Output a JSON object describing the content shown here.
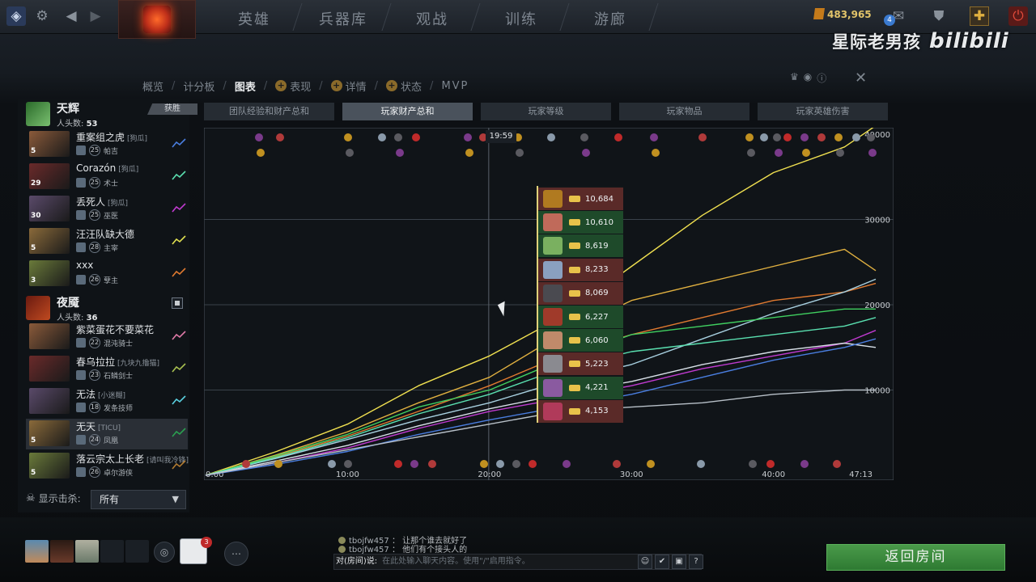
{
  "topbar": {
    "nav": [
      "英雄",
      "兵器库",
      "观战",
      "训练",
      "游廊"
    ],
    "gold": "483,965",
    "notif_count": "4",
    "watermark": "星际老男孩",
    "watermark_brand": "bilibili"
  },
  "subtabs": [
    "概览",
    "计分板",
    "图表",
    "表现",
    "详情",
    "状态",
    "MVP"
  ],
  "graph_tabs": [
    "团队经验和财产总和",
    "玩家财产总和",
    "玩家等级",
    "玩家物品",
    "玩家英雄伤害"
  ],
  "radiant": {
    "name": "天辉",
    "kills_label": "人头数:",
    "kills": "53",
    "result": "获胜",
    "players": [
      {
        "name": "重案组之虎",
        "tag": "[狗瓜]",
        "level": "25",
        "hero": "帕吉",
        "plevel": "5",
        "color": "#4a7ee0"
      },
      {
        "name": "Corazón",
        "tag": "[狗瓜]",
        "level": "25",
        "hero": "术士",
        "plevel": "29",
        "color": "#5ae0b0"
      },
      {
        "name": "丢死人",
        "tag": "[狗瓜]",
        "level": "25",
        "hero": "巫医",
        "plevel": "30",
        "color": "#c03ad0"
      },
      {
        "name": "汪汪队缺大德",
        "tag": "",
        "level": "28",
        "hero": "主宰",
        "plevel": "5",
        "color": "#e0e050"
      },
      {
        "name": "xxx",
        "tag": "",
        "level": "26",
        "hero": "孽主",
        "plevel": "3",
        "color": "#e07a30"
      }
    ]
  },
  "dire": {
    "name": "夜魇",
    "kills_label": "人头数:",
    "kills": "36",
    "players": [
      {
        "name": "紫菜蛋花不要菜花",
        "tag": "",
        "level": "22",
        "hero": "混沌骑士",
        "plevel": "",
        "color": "#e07aa8"
      },
      {
        "name": "春乌拉拉",
        "tag": "[九块九撸猫]",
        "level": "23",
        "hero": "石鳞剑士",
        "plevel": "",
        "color": "#a8c050"
      },
      {
        "name": "无法",
        "tag": "[小迷糊]",
        "level": "18",
        "hero": "发条技师",
        "plevel": "",
        "color": "#5ad0e0"
      },
      {
        "name": "无天",
        "tag": "[TICU]",
        "level": "24",
        "hero": "凤凰",
        "plevel": "5",
        "color": "#2aa050"
      },
      {
        "name": "落云宗太上长老",
        "tag": "[请叫我冷锋]",
        "level": "26",
        "hero": "卓尔游侠",
        "plevel": "5",
        "color": "#b07a30"
      }
    ]
  },
  "kill_filter": {
    "label": "显示击杀:",
    "value": "所有"
  },
  "chart_data": {
    "type": "line",
    "title": "玩家财产总和",
    "x_ticks": [
      "0:00",
      "10:00",
      "20:00",
      "30:00",
      "40:00",
      "47:13"
    ],
    "y_ticks": [
      "40000",
      "30000",
      "20000",
      "10000"
    ],
    "xlim": [
      0,
      47.2
    ],
    "ylim": [
      0,
      40000
    ],
    "x": [
      0,
      5,
      10,
      15,
      20,
      25,
      30,
      35,
      40,
      45,
      47.2
    ],
    "series": [
      {
        "color": "#f0e050",
        "values": [
          0,
          2800,
          6000,
          10500,
          14000,
          18500,
          24500,
          30500,
          35500,
          38500,
          41000
        ]
      },
      {
        "color": "#e0b040",
        "values": [
          0,
          2400,
          5100,
          8500,
          11500,
          16500,
          20500,
          22500,
          24500,
          26500,
          24000
        ]
      },
      {
        "color": "#e07a30",
        "values": [
          0,
          2200,
          4600,
          7500,
          10500,
          14000,
          16500,
          18500,
          20500,
          21500,
          22500
        ]
      },
      {
        "color": "#a8d0e0",
        "values": [
          0,
          2000,
          4200,
          6500,
          8500,
          11000,
          13000,
          16000,
          19000,
          21500,
          23000
        ]
      },
      {
        "color": "#40d060",
        "values": [
          0,
          2300,
          4800,
          8000,
          10000,
          13500,
          16500,
          17500,
          18500,
          19500,
          19500
        ]
      },
      {
        "color": "#5ae0b0",
        "values": [
          0,
          2100,
          4400,
          7200,
          9500,
          12500,
          14500,
          15500,
          16500,
          17500,
          18500
        ]
      },
      {
        "color": "#c03ad0",
        "values": [
          0,
          1500,
          3200,
          5500,
          7500,
          9000,
          10500,
          12500,
          14000,
          15500,
          17000
        ]
      },
      {
        "color": "#d8e0e8",
        "values": [
          0,
          1700,
          3500,
          5800,
          7800,
          9500,
          11000,
          13000,
          14500,
          15500,
          15000
        ]
      },
      {
        "color": "#4a7ee0",
        "values": [
          0,
          1300,
          2800,
          4800,
          6500,
          8000,
          9500,
          11500,
          13500,
          15000,
          16000
        ]
      },
      {
        "color": "#b8c0c8",
        "values": [
          0,
          1500,
          3000,
          4500,
          6000,
          7500,
          8000,
          8500,
          9500,
          10000,
          10000
        ]
      }
    ]
  },
  "time_marker": "19:59",
  "tooltip": [
    {
      "value": "10,684",
      "bg": "#5a2a28",
      "icon": "#b07a20"
    },
    {
      "value": "10,610",
      "bg": "#1e4a2a",
      "icon": "#c06a5a"
    },
    {
      "value": "8,619",
      "bg": "#1e4a2a",
      "icon": "#7ab060"
    },
    {
      "value": "8,233",
      "bg": "#5a2a28",
      "icon": "#8aa0c0"
    },
    {
      "value": "8,069",
      "bg": "#5a2a28",
      "icon": "#4a4a50"
    },
    {
      "value": "6,227",
      "bg": "#1e4a2a",
      "icon": "#a03a2a"
    },
    {
      "value": "6,060",
      "bg": "#1e4a2a",
      "icon": "#c08a6a"
    },
    {
      "value": "5,223",
      "bg": "#5a2a28",
      "icon": "#8a8a90"
    },
    {
      "value": "4,221",
      "bg": "#1e4a2a",
      "icon": "#8a5aa0"
    },
    {
      "value": "4,153",
      "bg": "#5a2a28",
      "icon": "#b03a5a"
    }
  ],
  "chat": {
    "lines": [
      {
        "user": "tbojfw457",
        "text": "让那个谁去就好了"
      },
      {
        "user": "tbojfw457",
        "text": "他们有个接头人的"
      }
    ],
    "prefix": "对(房间)说:",
    "placeholder": "在此处输入聊天内容。使用\"/\"启用指令。"
  },
  "party_notif": "3",
  "return_button": "返回房间"
}
